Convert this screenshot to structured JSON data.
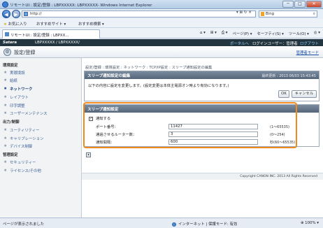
{
  "window": {
    "title": "リモートUI : 設定/登録 : LBPXXXXX: LBPXXXXX- Windows Internet Explorer",
    "min": "─",
    "max": "□",
    "close": "✕"
  },
  "address": {
    "url": "http://",
    "search_engine": "Bing",
    "tools": "▾ ⊠ ↻ ✕"
  },
  "favorites": {
    "label": "お気に入り",
    "items": [
      "おすすめサイト ▾",
      "おすすめ検索 ▾"
    ]
  },
  "tab": {
    "label": "リモートUI : 設定/登録 : LBPXX...",
    "commands": [
      "ページ(P) ▾",
      "セーフティ(S) ▾",
      "ツール(O) ▾",
      "◎ ▾"
    ]
  },
  "app": {
    "brand": "Satera",
    "device": "LBPXXXXX / LBPXXXXX/",
    "portal": "ポータルへ",
    "login_user": "ログインユーザー：管理者",
    "logout": "ログアウト",
    "page_title": "設定/登録",
    "manager_mode": "管理者モード"
  },
  "sidebar": {
    "sections": [
      {
        "title": "環境設定",
        "items": [
          "実環境設",
          "給紙",
          "ネットワーク",
          "レイアウト",
          "印字調整",
          "ユーザーメンテナンス"
        ]
      },
      {
        "title": "出力/制御",
        "items": [
          "ユーティリティー",
          "キャリブレーション",
          "デバイス制御"
        ]
      },
      {
        "title": "管理設定",
        "items": [
          "セキュリティー",
          "ライセンス/その他"
        ]
      }
    ],
    "active": "ネットワーク"
  },
  "main": {
    "breadcrumb": "設定/登録 : 環境設定 : ネットワーク : TCP/IP設定 : スリープ通知設定の編集",
    "panel1": {
      "title": "スリープ通知設定の編集",
      "date": "最終更新 : 2013 06/03 15:43:45",
      "message": "以下の内容に設定を変更します。(設定変更は本体主電源オン時より有効になります。)",
      "ok": "OK",
      "cancel": "キャンセル"
    },
    "panel2": {
      "title": "スリープ通知設定",
      "checkbox_label": "通知する",
      "checkbox_mark": "✓",
      "fields": [
        {
          "label": "ポート番号：",
          "value": "11427",
          "range": "(1〜65535)"
        },
        {
          "label": "通過させるルーター数：",
          "value": "3",
          "range": "(0〜254)"
        },
        {
          "label": "通知間隔：",
          "value": "600",
          "range": "秒(60〜65535)"
        }
      ]
    },
    "copyright": "Copyright CANON INC. 2013 All Rights Reserved"
  },
  "status": {
    "left": "ページが表示されました",
    "zone": "インターネット | 保護モード: 有効",
    "zoom": "⊕ 100%  ▾"
  }
}
